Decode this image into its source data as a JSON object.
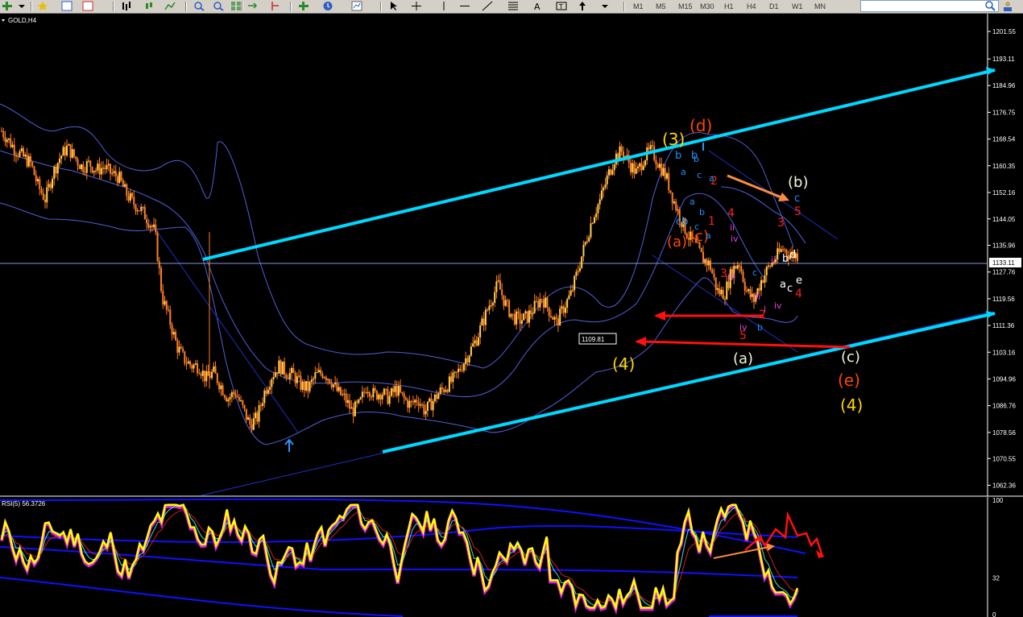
{
  "toolbar": {
    "timeframes": [
      "M1",
      "M5",
      "M15",
      "M30",
      "H1",
      "H4",
      "D1",
      "W1",
      "MN"
    ]
  },
  "chart_data": {
    "type": "candlestick",
    "symbol_label": "GOLD,H4",
    "current_price_label": "1133.11",
    "low_marker_label": "1109.81",
    "price_axis": {
      "ylim": [
        1059,
        1207
      ],
      "ticks": [
        "1201.55",
        "1193.11",
        "1184.96",
        "1176.75",
        "1168.54",
        "1160.35",
        "1152.16",
        "1144.05",
        "1135.96",
        "1127.76",
        "1119.56",
        "1111.36",
        "1103.16",
        "1094.96",
        "1086.76",
        "1078.56",
        "1070.55",
        "1062.36"
      ]
    },
    "price_path": [
      1171,
      1168,
      1165,
      1163,
      1161,
      1154,
      1150,
      1158,
      1163,
      1166,
      1163,
      1160,
      1161,
      1159,
      1160,
      1158,
      1157,
      1152,
      1149,
      1147,
      1144,
      1140,
      1120,
      1113,
      1105,
      1101,
      1099,
      1099,
      1095,
      1097,
      1093,
      1089,
      1091,
      1086,
      1081,
      1083,
      1091,
      1096,
      1099,
      1097,
      1096,
      1093,
      1092,
      1096,
      1097,
      1095,
      1091,
      1089,
      1085,
      1087,
      1093,
      1090,
      1091,
      1089,
      1092,
      1089,
      1087,
      1089,
      1085,
      1088,
      1091,
      1093,
      1095,
      1099,
      1103,
      1107,
      1113,
      1119,
      1124,
      1118,
      1114,
      1113,
      1114,
      1117,
      1120,
      1116,
      1112,
      1117,
      1121,
      1129,
      1137,
      1145,
      1150,
      1157,
      1163,
      1165,
      1161,
      1158,
      1163,
      1165,
      1161,
      1157,
      1150,
      1144,
      1139,
      1136,
      1132,
      1130,
      1122,
      1121,
      1128,
      1131,
      1122,
      1119,
      1125,
      1129,
      1132,
      1135,
      1133,
      1133
    ],
    "rsi": {
      "label": "RSI(5) 56.3726",
      "axis_ticks": [
        "100",
        "32",
        "0"
      ],
      "ylim": [
        0,
        100
      ]
    },
    "wave_labels": [
      {
        "text": "(3)",
        "color": "#ffd700"
      },
      {
        "text": "(d)",
        "color": "#ff4500"
      },
      {
        "text": "(b)",
        "color": "#f5f5dc"
      },
      {
        "text": "(a)",
        "color": "#ff4500"
      },
      {
        "text": "(c)",
        "color": "#ff4500"
      },
      {
        "text": "(4)",
        "color": "#ffd700"
      },
      {
        "text": "(a)",
        "color": "#f5f5dc"
      },
      {
        "text": "(c)",
        "color": "#f5f5dc"
      },
      {
        "text": "(e)",
        "color": "#ff4500"
      },
      {
        "text": "(4)",
        "color": "#ffd700"
      },
      {
        "text": "1",
        "color": "#ff2020"
      },
      {
        "text": "2",
        "color": "#ff2020"
      },
      {
        "text": "3",
        "color": "#ff2020"
      },
      {
        "text": "4",
        "color": "#ff2020"
      },
      {
        "text": "5",
        "color": "#ff2020"
      },
      {
        "text": "3",
        "color": "#ff2020"
      },
      {
        "text": "4",
        "color": "#ff2020"
      },
      {
        "text": "5",
        "color": "#ff2020"
      },
      {
        "text": "2",
        "color": "#ff2020"
      },
      {
        "text": "ii",
        "color": "#e040e0"
      },
      {
        "text": "iv",
        "color": "#e040e0"
      },
      {
        "text": "iii",
        "color": "#e040e0"
      },
      {
        "text": "iv",
        "color": "#e040e0"
      },
      {
        "text": "ii",
        "color": "#e040e0"
      },
      {
        "text": "iv",
        "color": "#e040e0"
      },
      {
        "text": "i",
        "color": "#e040e0"
      },
      {
        "text": "iii",
        "color": "#e040e0"
      },
      {
        "text": "b",
        "color": "#1e90ff"
      },
      {
        "text": "b",
        "color": "#1e90ff"
      },
      {
        "text": "a",
        "color": "#1e90ff"
      },
      {
        "text": "cb",
        "color": "#1e90ff"
      },
      {
        "text": "a",
        "color": "#1e90ff"
      },
      {
        "text": "c",
        "color": "#1e90ff"
      },
      {
        "text": "b",
        "color": "#1e90ff"
      },
      {
        "text": "a",
        "color": "#1e90ff"
      },
      {
        "text": "c",
        "color": "#1e90ff"
      },
      {
        "text": "a",
        "color": "#1e90ff"
      },
      {
        "text": "b",
        "color": "#1e90ff"
      },
      {
        "text": "b",
        "color": "#1e90ff"
      },
      {
        "text": "c",
        "color": "#1e90ff"
      },
      {
        "text": "c",
        "color": "#1e90ff"
      },
      {
        "text": "d",
        "color": "#ffffff"
      },
      {
        "text": "b",
        "color": "#ffffff"
      },
      {
        "text": "a",
        "color": "#ffffff"
      },
      {
        "text": "c",
        "color": "#ffffff"
      },
      {
        "text": "e",
        "color": "#ffffff"
      }
    ]
  }
}
